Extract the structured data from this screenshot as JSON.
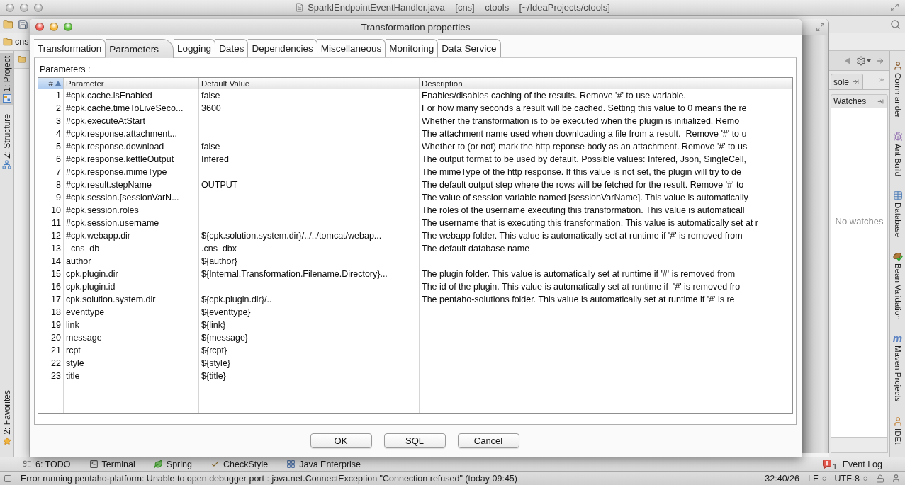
{
  "ide": {
    "title": "SparklEndpointEventHandler.java – [cns] – ctools – [~/IdeaProjects/ctools]",
    "breadcrumb": "cns",
    "left_tool_tabs": {
      "top": [
        {
          "label": "1: Project",
          "kind": "project",
          "selected": true
        },
        {
          "label": "Z: Structure",
          "kind": "structure",
          "selected": false
        }
      ],
      "bottom": [
        {
          "label": "2: Favorites",
          "kind": "favorites",
          "selected": false
        }
      ]
    },
    "right_tool_tabs": [
      {
        "label": "Commander",
        "kind": "commander",
        "selected": false
      },
      {
        "label": "Ant Build",
        "kind": "ant",
        "selected": false
      },
      {
        "label": "Database",
        "kind": "database",
        "selected": false
      },
      {
        "label": "Bean Validation",
        "kind": "bean",
        "selected": false
      },
      {
        "label": "Maven Projects",
        "kind": "maven",
        "glyph": "m",
        "selected": false
      },
      {
        "label": "IDEt",
        "kind": "plugin",
        "selected": false
      }
    ],
    "debug_panel": {
      "tab": "sole",
      "header": "Watches",
      "empty_text": "No watches"
    },
    "bottom_tool_tabs": [
      {
        "label": "6: TODO",
        "kind": "todo",
        "selected": false
      },
      {
        "label": "Terminal",
        "kind": "terminal",
        "selected": false
      },
      {
        "label": "Spring",
        "kind": "spring",
        "selected": false
      },
      {
        "label": "CheckStyle",
        "kind": "checkstyle",
        "selected": false
      },
      {
        "label": "Java Enterprise",
        "kind": "javaee",
        "selected": false
      }
    ],
    "event_log": {
      "label": "Event Log",
      "count": "1"
    },
    "status_bar": {
      "message": "Error running pentaho-platform: Unable to open debugger port : java.net.ConnectException \"Connection refused\" (today 09:45)",
      "position": "32:40/26",
      "line_separator": "LF",
      "encoding": "UTF-8"
    }
  },
  "dialog": {
    "title": "Transformation properties",
    "tabs": [
      {
        "label": "Transformation",
        "selected": false
      },
      {
        "label": "Parameters",
        "selected": true
      },
      {
        "label": "Logging",
        "selected": false
      },
      {
        "label": "Dates",
        "selected": false
      },
      {
        "label": "Dependencies",
        "selected": false
      },
      {
        "label": "Miscellaneous",
        "selected": false
      },
      {
        "label": "Monitoring",
        "selected": false
      },
      {
        "label": "Data Service",
        "selected": false
      }
    ],
    "section_label": "Parameters :",
    "table": {
      "columns": [
        {
          "label": "#",
          "kind": "number",
          "sorted": true
        },
        {
          "label": "Parameter",
          "kind": "text",
          "sorted": false
        },
        {
          "label": "Default Value",
          "kind": "text",
          "sorted": false
        },
        {
          "label": "Description",
          "kind": "text",
          "sorted": false
        }
      ],
      "rows": [
        {
          "number": "1",
          "parameter": "#cpk.cache.isEnabled",
          "default_value": "false",
          "description": "Enables/disables caching of the results. Remove '#' to use variable."
        },
        {
          "number": "2",
          "parameter": "#cpk.cache.timeToLiveSeco...",
          "default_value": "3600",
          "description": "For how many seconds a result will be cached. Setting this value to 0 means the re"
        },
        {
          "number": "3",
          "parameter": "#cpk.executeAtStart",
          "description": "Whether the transformation is to be executed when the plugin is initialized. Remo"
        },
        {
          "number": "4",
          "parameter": "#cpk.response.attachment...",
          "description": "The attachment name used when downloading a file from a result.  Remove '#' to u"
        },
        {
          "number": "5",
          "parameter": "#cpk.response.download",
          "default_value": "false",
          "description": "Whether to (or not) mark the http reponse body as an attachment. Remove '#' to us"
        },
        {
          "number": "6",
          "parameter": "#cpk.response.kettleOutput",
          "default_value": "Infered",
          "description": "The output format to be used by default. Possible values: Infered, Json, SingleCell,"
        },
        {
          "number": "7",
          "parameter": "#cpk.response.mimeType",
          "description": "The mimeType of the http response. If this value is not set, the plugin will try to de"
        },
        {
          "number": "8",
          "parameter": "#cpk.result.stepName",
          "default_value": "OUTPUT",
          "description": "The default output step where the rows will be fetched for the result. Remove '#' to"
        },
        {
          "number": "9",
          "parameter": "#cpk.session.[sessionVarN...",
          "description": "The value of session variable named [sessionVarName]. This value is automatically"
        },
        {
          "number": "10",
          "parameter": "#cpk.session.roles",
          "description": "The roles of the username executing this transformation. This value is automaticall"
        },
        {
          "number": "11",
          "parameter": "#cpk.session.username",
          "description": "The username that is executing this transformation. This value is automatically set at r"
        },
        {
          "number": "12",
          "parameter": "#cpk.webapp.dir",
          "default_value": "${cpk.solution.system.dir}/../../tomcat/webap...",
          "description": "The webapp folder. This value is automatically set at runtime if '#' is removed from"
        },
        {
          "number": "13",
          "parameter": "_cns_db",
          "default_value": ".cns_dbx",
          "description": "The default database name"
        },
        {
          "number": "14",
          "parameter": "author",
          "default_value": "${author}"
        },
        {
          "number": "15",
          "parameter": "cpk.plugin.dir",
          "default_value": "${Internal.Transformation.Filename.Directory}...",
          "description": "The plugin folder. This value is automatically set at runtime if '#' is removed from"
        },
        {
          "number": "16",
          "parameter": "cpk.plugin.id",
          "description": "The id of the plugin. This value is automatically set at runtime if  '#' is removed fro"
        },
        {
          "number": "17",
          "parameter": "cpk.solution.system.dir",
          "default_value": "${cpk.plugin.dir}/..",
          "description": "The pentaho-solutions folder. This value is automatically set at runtime if '#' is re"
        },
        {
          "number": "18",
          "parameter": "eventtype",
          "default_value": "${eventtype}"
        },
        {
          "number": "19",
          "parameter": "link",
          "default_value": "${link}"
        },
        {
          "number": "20",
          "parameter": "message",
          "default_value": "${message}"
        },
        {
          "number": "21",
          "parameter": "rcpt",
          "default_value": "${rcpt}"
        },
        {
          "number": "22",
          "parameter": "style",
          "default_value": "${style}"
        },
        {
          "number": "23",
          "parameter": "title",
          "default_value": "${title}"
        }
      ]
    },
    "buttons": [
      "OK",
      "SQL",
      "Cancel"
    ]
  }
}
